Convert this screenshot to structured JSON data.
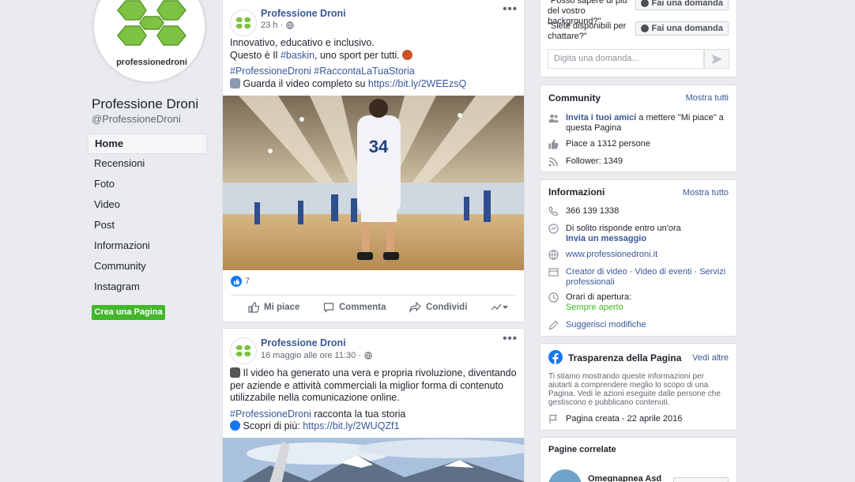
{
  "page": {
    "name": "Professione Droni",
    "handle": "@ProfessioneDroni",
    "logo_text": "professionedroni",
    "brand_color": "#7dc242"
  },
  "nav": {
    "items": [
      "Home",
      "Recensioni",
      "Foto",
      "Video",
      "Post",
      "Informazioni",
      "Community",
      "Instagram"
    ],
    "active": "Home",
    "create_page_label": "Crea una Pagina"
  },
  "posts": [
    {
      "author": "Professione Droni",
      "meta": "23 h ·",
      "lines": [
        "Innovativo, educativo e inclusivo.",
        "Questo è Il ",
        "#baskin",
        ", uno sport per tutti. "
      ],
      "hashtags": "#ProfessioneDroni #RaccontaLaTuaStoria",
      "video_text": "Guarda il video completo su ",
      "video_link": "https://bit.ly/2WEEzsQ",
      "jersey_number": "34",
      "reaction_count": "7",
      "actions": {
        "like": "Mi piace",
        "comment": "Commenta",
        "share": "Condividi"
      }
    },
    {
      "author": "Professione Droni",
      "meta": "16 maggio alle ore 11:30 ·",
      "text": "Il video ha generato una vera e propria rivoluzione, diventando per aziende e attività commerciali la miglior forma di contenuto utilizzabile nella comunicazione online.",
      "hashtag": "#ProfessioneDroni",
      "hashtag_rest": " racconta la tua storia",
      "info_text": "Scopri di più: ",
      "info_link": "https://bit.ly/2WUQZf1"
    }
  ],
  "qa": {
    "questions": [
      {
        "text": "\"Posso sapere di più del vostro background?\"",
        "button": "Fai una domanda"
      },
      {
        "text": "\"Siete disponibili per chattare?\"",
        "button": "Fai una domanda"
      }
    ],
    "input_placeholder": "Digita una domanda..."
  },
  "community": {
    "title": "Community",
    "see_all": "Mostra tutti",
    "invite_link": "Invita i tuoi amici",
    "invite_rest": " a mettere \"Mi piace\" a questa Pagina",
    "likes": "Piace a 1312 persone",
    "followers": "Follower: 1349"
  },
  "info": {
    "title": "Informazioni",
    "see_all": "Mostra tutto",
    "phone": "366 139 1338",
    "response": "Di solito risponde entro un'ora",
    "send_message": "Invia un messaggio",
    "website": "www.professionedroni.it",
    "cat1": "Creator di video",
    "cat2": "Video di eventi",
    "cat3": "Servizi professionali",
    "hours_label": "Orari di apertura:",
    "hours_value": "Sempre aperto",
    "suggest": "Suggerisci modifiche"
  },
  "transparency": {
    "title": "Trasparenza della Pagina",
    "see_more": "Vedi altre",
    "description": "Ti stiamo mostrando queste informazioni per aiutarti a comprendere meglio lo scopo di una Pagina. Vedi le azioni eseguite dalle persone che gestiscono e pubblicano contenuti.",
    "created": "Pagina creata - 22 aprile 2016"
  },
  "related": {
    "title": "Pagine correlate",
    "first_page": "Omegnapnea Asd"
  },
  "colors": {
    "link": "#385898",
    "background": "#e9ebee",
    "green_button": "#42b72a",
    "facebook_blue": "#1877f2"
  }
}
